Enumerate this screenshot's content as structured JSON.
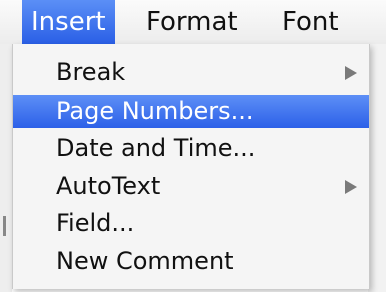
{
  "menubar": {
    "items": [
      {
        "label": "Insert",
        "active": true
      },
      {
        "label": "Format",
        "active": false
      },
      {
        "label": "Font",
        "active": false
      }
    ]
  },
  "dropdown": {
    "items": [
      {
        "label": "Break",
        "submenu": true,
        "selected": false
      },
      {
        "label": "Page Numbers...",
        "submenu": false,
        "selected": true
      },
      {
        "label": "Date and Time...",
        "submenu": false,
        "selected": false
      },
      {
        "label": "AutoText",
        "submenu": true,
        "selected": false
      },
      {
        "label": "Field...",
        "submenu": false,
        "selected": false
      },
      {
        "label": "New Comment",
        "submenu": false,
        "selected": false
      }
    ]
  },
  "icons": {
    "submenu_arrow": "chevron-right-icon"
  },
  "colors": {
    "highlight": "#3a6ef0",
    "menu_background": "#f5f5f5",
    "text": "#111111",
    "highlight_text": "#ffffff"
  }
}
